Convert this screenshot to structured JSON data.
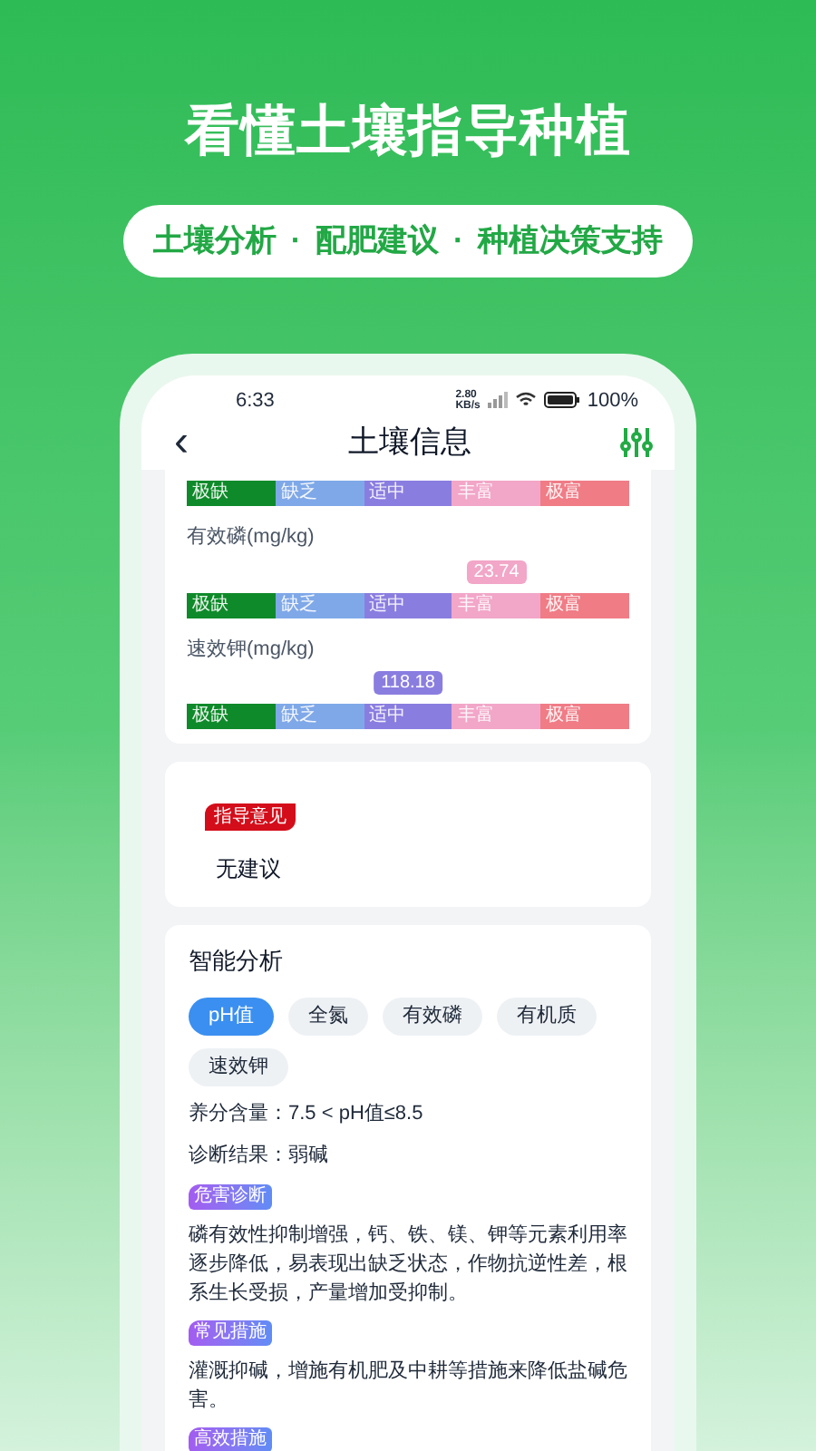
{
  "headline": "看懂土壤指导种植",
  "features": [
    "土壤分析",
    "配肥建议",
    "种植决策支持"
  ],
  "separator": "·",
  "status_bar": {
    "time": "6:33",
    "speed_value": "2.80",
    "speed_unit": "KB/s",
    "battery": "100%"
  },
  "header": {
    "back": "‹",
    "title": "土壤信息"
  },
  "nutrients": [
    {
      "scale": [
        "极缺",
        "缺乏",
        "适中",
        "丰富",
        "极富"
      ]
    },
    {
      "name": "有效磷(mg/kg)",
      "value": "23.74",
      "level": 0.7,
      "scale": [
        "极缺",
        "缺乏",
        "适中",
        "丰富",
        "极富"
      ]
    },
    {
      "name": "速效钾(mg/kg)",
      "value": "118.18",
      "level": 0.5,
      "scale": [
        "极缺",
        "缺乏",
        "适中",
        "丰富",
        "极富"
      ]
    }
  ],
  "guidance": {
    "tag": "指导意见",
    "text": "无建议"
  },
  "analysis": {
    "title": "智能分析",
    "tabs": [
      {
        "label": "pH值",
        "selected": true
      },
      {
        "label": "全氮",
        "selected": false
      },
      {
        "label": "有效磷",
        "selected": false
      },
      {
        "label": "有机质",
        "selected": false
      },
      {
        "label": "速效钾",
        "selected": false
      }
    ],
    "lines": [
      "养分含量：7.5 < pH值≤8.5",
      "诊断结果：弱碱"
    ],
    "sections": [
      {
        "tag": "危害诊断",
        "text": "磷有效性抑制增强，钙、铁、镁、钾等元素利用率逐步降低，易表现出缺乏状态，作物抗逆性差，根系生长受损，产量增加受抑制。"
      },
      {
        "tag": "常见措施",
        "text": "灌溉抑碱，增施有机肥及中耕等措施来降低盐碱危害。"
      },
      {
        "tag": "高效措施"
      }
    ]
  }
}
